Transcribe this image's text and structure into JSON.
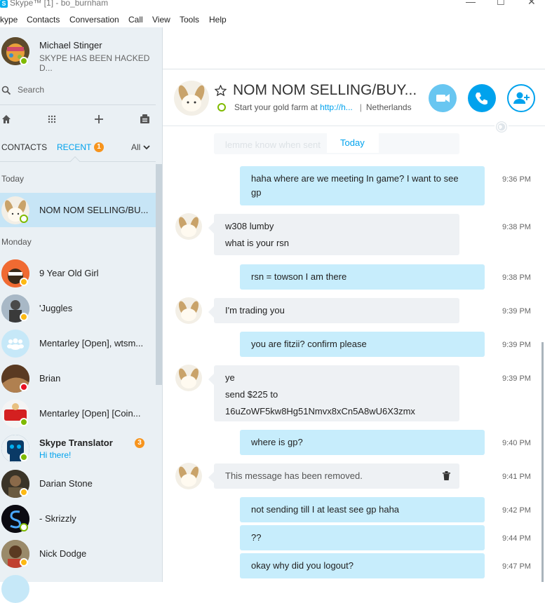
{
  "window": {
    "title": "Skype™ [1] - bo_burnham",
    "logo_letter": "S",
    "min": "—",
    "max": "☐",
    "close": "✕"
  },
  "menu": [
    "kype",
    "Contacts",
    "Conversation",
    "Call",
    "View",
    "Tools",
    "Help"
  ],
  "profile": {
    "name": "Michael Stinger",
    "mood": "SKYPE HAS BEEN HACKED D..."
  },
  "search": {
    "placeholder": "Search"
  },
  "tabs": {
    "contacts": "CONTACTS",
    "recent": "RECENT",
    "recent_badge": "1",
    "filter": "All"
  },
  "sidebar": {
    "today_label": "Today",
    "monday_label": "Monday",
    "active": {
      "name": "NOM NOM SELLING/BU..."
    },
    "contacts": [
      {
        "name": "9 Year Old Girl"
      },
      {
        "name": "'Juggles"
      },
      {
        "name": "Mentarley [Open], wtsm..."
      },
      {
        "name": "Brian"
      },
      {
        "name": "Mentarley [Open] [Coin..."
      },
      {
        "name": "Skype Translator",
        "sub": "Hi there!",
        "badge": "3"
      },
      {
        "name": "Darian Stone"
      },
      {
        "name": "- Skrizzly"
      },
      {
        "name": "Nick Dodge"
      }
    ]
  },
  "conversation": {
    "title": "NOM NOM SELLING/BUY...",
    "mood_prefix": "Start your gold farm at ",
    "mood_link": "http://h...",
    "location": "Netherlands",
    "faded_message": "lemme know when sent",
    "day_divider": "Today"
  },
  "messages": [
    {
      "dir": "out",
      "lines": [
        "haha where are we meeting In game? I want to see",
        "gp"
      ],
      "time": "9:36 PM"
    },
    {
      "dir": "in",
      "lines": [
        "w308 lumby",
        "what is your rsn"
      ],
      "time": "9:38 PM"
    },
    {
      "dir": "out",
      "lines": [
        "rsn = towson I am there"
      ],
      "time": "9:38 PM"
    },
    {
      "dir": "in",
      "lines": [
        "I'm trading you"
      ],
      "time": "9:39 PM"
    },
    {
      "dir": "out",
      "lines": [
        "you are fitzii? confirm please"
      ],
      "time": "9:39 PM"
    },
    {
      "dir": "in",
      "lines": [
        "ye",
        "send $225 to",
        "16uZoWF5kw8Hg51Nmvx8xCn5A8wU6X3zmx"
      ],
      "time": "9:39 PM"
    },
    {
      "dir": "out",
      "lines": [
        "where is gp?"
      ],
      "time": "9:40 PM"
    },
    {
      "dir": "in",
      "lines": [
        "This message has been removed."
      ],
      "time": "9:41 PM",
      "removed": true
    },
    {
      "dir": "out",
      "lines": [
        "not sending till I at least see gp haha"
      ],
      "time": "9:42 PM"
    },
    {
      "dir": "out",
      "lines": [
        "??"
      ],
      "time": "9:44 PM"
    },
    {
      "dir": "out",
      "lines": [
        "okay why did you logout?"
      ],
      "time": "9:47 PM"
    }
  ],
  "colors": {
    "skype_blue": "#00aff0",
    "button_blue": "#00a2ed",
    "outgoing_bubble": "#c7edfc",
    "incoming_bubble": "#eef1f4",
    "selected_row": "#c7e5f6",
    "badge_orange": "#f7941d"
  }
}
